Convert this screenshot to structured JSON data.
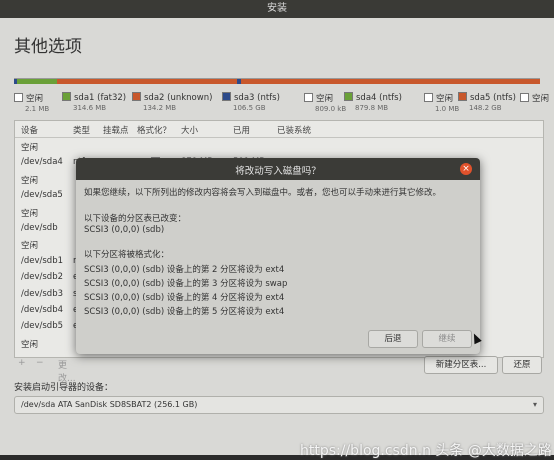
{
  "window": {
    "title": "安装"
  },
  "page": {
    "title": "其他选项"
  },
  "partition_bar": [
    {
      "color": "#2c4a8a",
      "flex": 3
    },
    {
      "color": "#6aa038",
      "flex": 40
    },
    {
      "color": "#c8582c",
      "flex": 180
    },
    {
      "color": "#2c4a8a",
      "flex": 4
    },
    {
      "color": "#c8582c",
      "flex": 300
    }
  ],
  "legend": [
    {
      "name": "空闲",
      "size": "2.1 MB",
      "color": "#ffffff"
    },
    {
      "name": "sda1 (fat32)",
      "size": "314.6 MB",
      "color": "#6aa038"
    },
    {
      "name": "sda2 (unknown)",
      "size": "134.2 MB",
      "color": "#c8582c"
    },
    {
      "name": "sda3 (ntfs)",
      "size": "106.5 GB",
      "color": "#2c4a8a"
    },
    {
      "name": "空闲",
      "size": "809.0 kB",
      "color": "#ffffff"
    },
    {
      "name": "sda4 (ntfs)",
      "size": "879.8 MB",
      "color": "#6aa038"
    },
    {
      "name": "空闲",
      "size": "1.0 MB",
      "color": "#ffffff"
    },
    {
      "name": "sda5 (ntfs)",
      "size": "148.2 GB",
      "color": "#c8582c"
    },
    {
      "name": "空闲",
      "size": "",
      "color": "#ffffff"
    }
  ],
  "table": {
    "headers": [
      "设备",
      "类型",
      "挂载点",
      "格式化？",
      "大小",
      "已用",
      "已装系统"
    ],
    "rows": [
      {
        "device": "空闲",
        "type": "",
        "size": "",
        "used": "",
        "check": false
      },
      {
        "device": "/dev/sda4",
        "type": "ntfs",
        "size": "879 MB",
        "used": "501 MB",
        "check": true
      },
      {
        "device": "空闲",
        "type": "",
        "size": "",
        "used": "",
        "check": false
      },
      {
        "device": "/dev/sda5",
        "type": "",
        "size": "",
        "used": "",
        "check": false
      },
      {
        "device": "空闲",
        "type": "",
        "size": "",
        "used": "",
        "check": false
      },
      {
        "device": "/dev/sdb",
        "type": "",
        "size": "",
        "used": "",
        "check": false
      },
      {
        "device": "空闲",
        "type": "",
        "size": "",
        "used": "",
        "check": false
      },
      {
        "device": "/dev/sdb1",
        "type": "n",
        "size": "",
        "used": "",
        "check": false
      },
      {
        "device": "/dev/sdb2",
        "type": "ex",
        "size": "",
        "used": "",
        "check": false
      },
      {
        "device": "/dev/sdb3",
        "type": "s",
        "size": "",
        "used": "",
        "check": false
      },
      {
        "device": "/dev/sdb4",
        "type": "ex",
        "size": "",
        "used": "",
        "check": false
      },
      {
        "device": "/dev/sdb5",
        "type": "ex",
        "size": "",
        "used": "",
        "check": false
      },
      {
        "device": "空闲",
        "type": "",
        "size": "",
        "used": "",
        "check": false
      }
    ]
  },
  "table_buttons": {
    "add": "+",
    "remove": "−",
    "change": "更改..."
  },
  "buttons": {
    "new_partition": "新建分区表...",
    "revert": "还原"
  },
  "boot": {
    "label": "安装启动引导器的设备：",
    "value": "/dev/sda   ATA SanDisk SD8SBAT2 (256.1 GB)"
  },
  "dialog": {
    "title": "将改动写入磁盘吗？",
    "intro": "如果您继续，以下所列出的修改内容将会写入到磁盘中。或者，您也可以手动来进行其它修改。",
    "changed_heading": "以下设备的分区表已改变：",
    "changed_device": "SCSI3 (0,0,0) (sdb)",
    "format_heading": "以下分区将被格式化：",
    "format_items": [
      "SCSI3 (0,0,0) (sdb) 设备上的第 2 分区将设为 ext4",
      "SCSI3 (0,0,0) (sdb) 设备上的第 3 分区将设为 swap",
      "SCSI3 (0,0,0) (sdb) 设备上的第 4 分区将设为 ext4",
      "SCSI3 (0,0,0) (sdb) 设备上的第 5 分区将设为 ext4"
    ],
    "back_button": "后退",
    "continue_button": "继续"
  },
  "watermark": "https://blog.csdn.n 头条 @大数据之路"
}
